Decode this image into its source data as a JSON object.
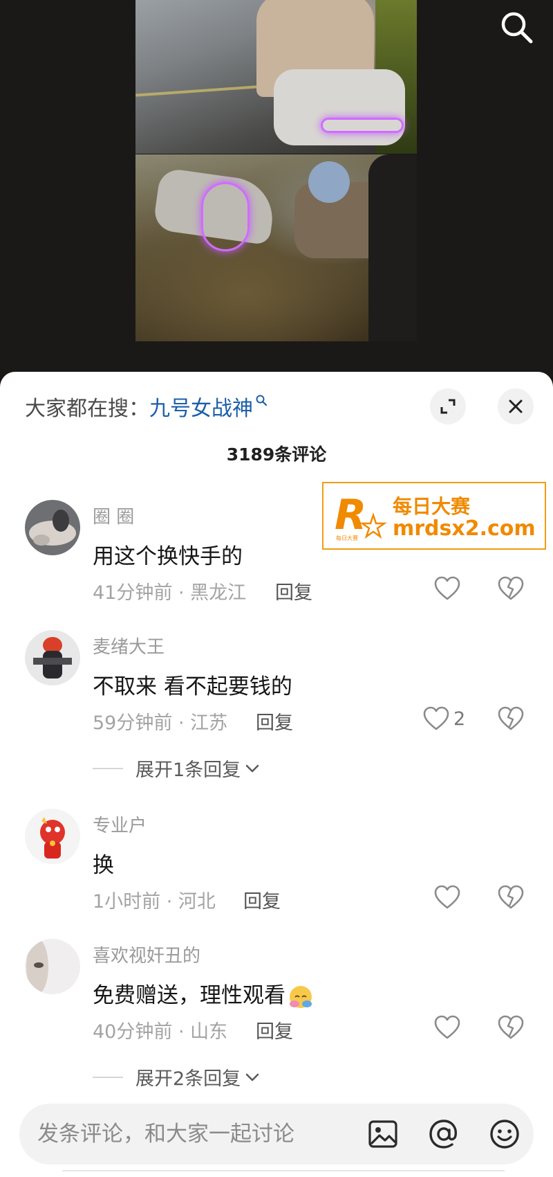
{
  "search": {
    "hot_label": "大家都在搜：",
    "hot_term": "九号女战神"
  },
  "comments_header": {
    "count_label": "3189条评论"
  },
  "comments": [
    {
      "username": "圈 圈",
      "text": "用这个换快手的",
      "meta": "41分钟前 · 黑龙江",
      "reply": "回复",
      "likes": ""
    },
    {
      "username": "麦绪大王",
      "text": "不取来 看不起要钱的",
      "meta": "59分钟前 · 江苏",
      "reply": "回复",
      "likes": "2",
      "expand": "展开1条回复"
    },
    {
      "username": "专业户",
      "text": "换",
      "meta": "1小时前 · 河北",
      "reply": "回复",
      "likes": ""
    },
    {
      "username": "喜欢视奸丑的",
      "text": "免费赠送，理性观看",
      "meta": "40分钟前 · 山东",
      "reply": "回复",
      "likes": "",
      "expand": "展开2条回复"
    }
  ],
  "watermark": {
    "logo_text": "每日大赛",
    "name": "每日大赛",
    "url": "mrdsx2.com"
  },
  "input": {
    "placeholder": "发条评论，和大家一起讨论"
  },
  "colors": {
    "hot_term": "#1b5ea8",
    "watermark": "#f08a00",
    "neon": "#d26bff"
  },
  "icons": [
    "search-icon",
    "expand-icon",
    "close-icon",
    "heart-icon",
    "broken-heart-icon",
    "image-icon",
    "at-icon",
    "emoji-icon",
    "chevron-down-icon",
    "hug-emoji-icon"
  ]
}
